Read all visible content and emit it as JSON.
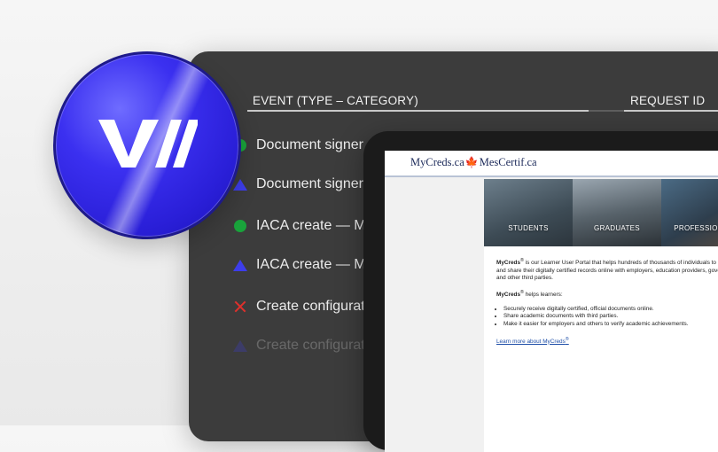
{
  "events_panel": {
    "headers": {
      "event": "EVENT (TYPE – CATEGORY)",
      "request_id": "REQUEST ID"
    },
    "rows": [
      {
        "status": "success",
        "color": "#19a33b",
        "label": "Document signer c"
      },
      {
        "status": "pending",
        "color": "#3d3dea",
        "label": "Document signer"
      },
      {
        "status": "success",
        "color": "#19a33b",
        "label": "IACA create — M"
      },
      {
        "status": "pending",
        "color": "#3d3dea",
        "label": "IACA create — M"
      },
      {
        "status": "failed",
        "color": "#e0302c",
        "label": "Create configurat"
      },
      {
        "status": "pending",
        "color": "#3d3dea",
        "label": "Create configurat"
      }
    ]
  },
  "logo": {
    "icon": "brand-logo-icon",
    "color": "#3b30f0"
  },
  "tablet": {
    "site_brand_left": "MyCreds.ca",
    "site_brand_right": "MesCertif.ca",
    "brand_icon": "maple-leaf-icon",
    "banner": [
      "STUDENTS",
      "GRADUATES",
      "PROFESSIONALS"
    ],
    "intro_prefix": "MyCreds",
    "reg": "®",
    "intro_rest": " is our Learner User Portal that helps hundreds of thousands of individuals to access and share their digitally certified records online with employers, education providers, governments, and other third parties.",
    "helps_prefix": "MyCreds",
    "helps_rest": " helps learners:",
    "bullets": [
      "Securely receive digitally certified, official documents online.",
      "Share academic documents with third parties.",
      "Make it easier for employers and others to verify academic achievements."
    ],
    "learn_more": "Learn more about MyCreds"
  }
}
